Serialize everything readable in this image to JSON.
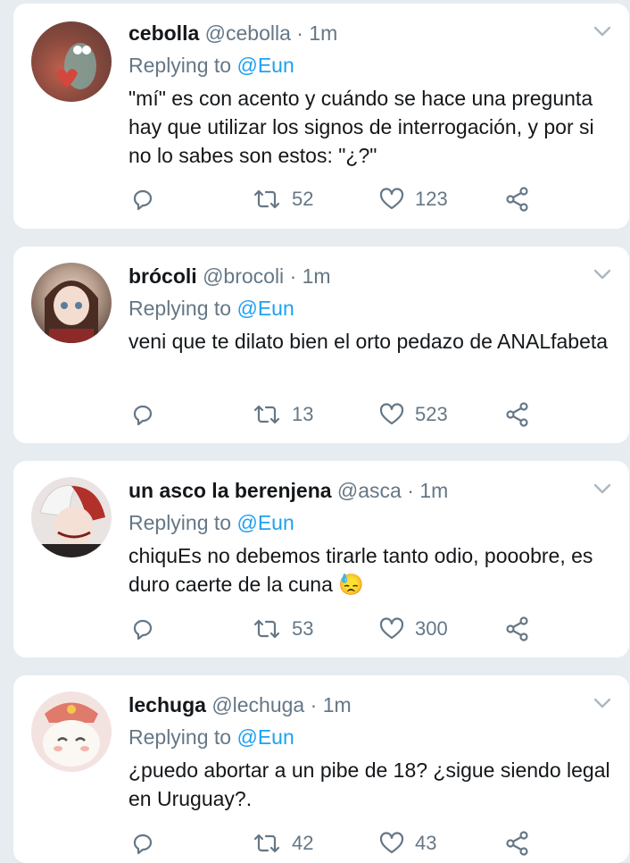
{
  "tweets": [
    {
      "display_name": "cebolla",
      "handle": "@cebolla",
      "time": "1m",
      "replying_label": "Replying to",
      "replying_to": "@Eun",
      "text": "\"mí\" es con acento y cuándo se hace una pregunta hay que utilizar los signos de interrogación, y por si no lo sabes son estos: \"¿?\"",
      "retweets": "52",
      "likes": "123"
    },
    {
      "display_name": "brócoli",
      "handle": "@brocoli",
      "time": "1m",
      "replying_label": "Replying to",
      "replying_to": "@Eun",
      "text": "veni que te dilato bien el orto pedazo de ANALfabeta",
      "retweets": "13",
      "likes": "523"
    },
    {
      "display_name": "un asco la berenjena",
      "handle": "@asca",
      "time": "1m",
      "replying_label": "Replying to",
      "replying_to": "@Eun",
      "text": "chiquEs no debemos tirarle tanto odio, pooobre, es duro caerte de la cuna",
      "emoji": "😓",
      "retweets": "53",
      "likes": "300"
    },
    {
      "display_name": "lechuga",
      "handle": "@lechuga",
      "time": "1m",
      "replying_label": "Replying to",
      "replying_to": "@Eun",
      "text": "¿puedo abortar a un pibe de 18? ¿sigue siendo legal en Uruguay?.",
      "retweets": "42",
      "likes": "43"
    }
  ],
  "colors": {
    "background": "#e6ecf0",
    "muted": "#657786",
    "link": "#1da1f2",
    "text": "#14171a"
  },
  "icons": [
    "reply-icon",
    "retweet-icon",
    "like-icon",
    "share-icon",
    "caret-down-icon"
  ]
}
